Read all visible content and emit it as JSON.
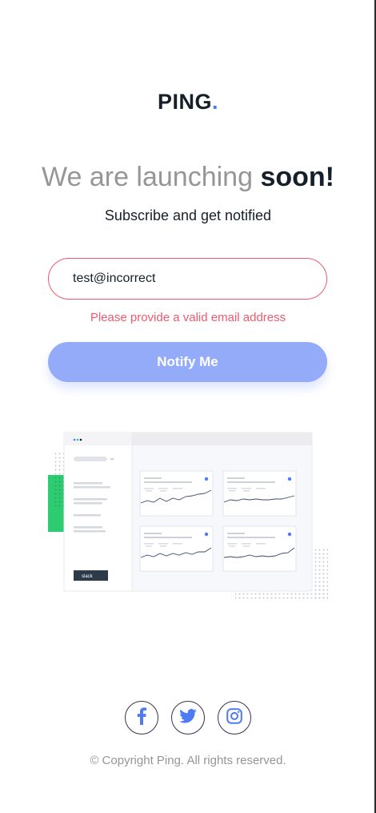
{
  "logo": {
    "text": "PING",
    "accent": "."
  },
  "hero": {
    "headline_light": "We are launching",
    "headline_bold": "soon!",
    "subheading": "Subscribe and get notified"
  },
  "form": {
    "email_value": "test@incorrect",
    "error_message": "Please provide a valid email address",
    "submit_label": "Notify Me"
  },
  "illustration": {
    "icon": "dashboard-illustration",
    "badge_text": "slack"
  },
  "socials": [
    {
      "name": "facebook",
      "icon": "facebook-icon"
    },
    {
      "name": "twitter",
      "icon": "twitter-icon"
    },
    {
      "name": "instagram",
      "icon": "instagram-icon"
    }
  ],
  "footer": {
    "copyright": "© Copyright Ping. All rights reserved."
  },
  "colors": {
    "brand_blue": "#4D7BF3",
    "pale_blue": "#94ABF9",
    "error_red": "#F0596E",
    "dark_navy": "#15202A",
    "gray": "#969696"
  }
}
